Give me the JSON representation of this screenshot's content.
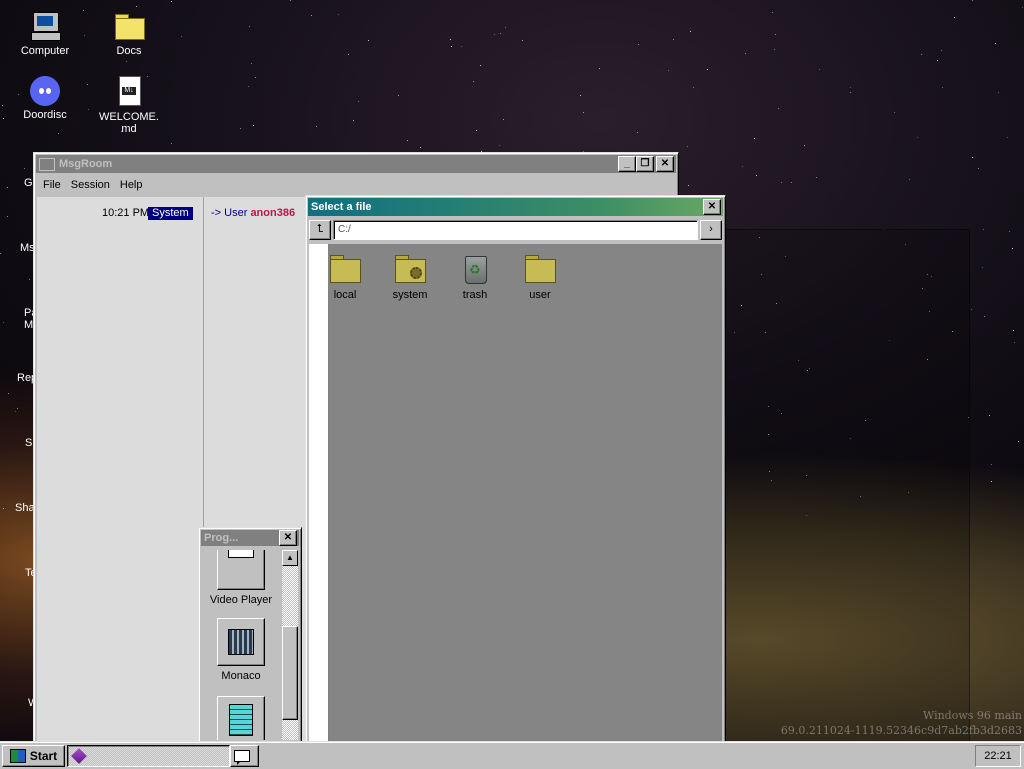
{
  "desktop": {
    "icons": [
      {
        "label": "Computer",
        "icon": "computer-icon"
      },
      {
        "label": "Docs",
        "icon": "folder-icon"
      },
      {
        "label": "Doordisc",
        "icon": "discord-icon"
      },
      {
        "label": "WELCOME.md",
        "icon": "markdown-file-icon"
      }
    ],
    "partial_labels": [
      "G",
      "Ms",
      "Pa",
      "M",
      "Rep",
      "S",
      "Sha",
      "Te",
      "W"
    ],
    "watermark": {
      "line1": "Windows 96 main",
      "line2": "69.0.211024-1119.52346c9d7ab2fb3d2683"
    }
  },
  "msgroom": {
    "title": "MsgRoom",
    "menu": [
      "File",
      "Session",
      "Help"
    ],
    "message": {
      "time": "10:21 PM",
      "sender": "System",
      "text_prefix": "-> User ",
      "user": "anon386"
    }
  },
  "file_dialog": {
    "title": "Select a file",
    "path": "C:/",
    "up_button": "⮤",
    "go_button": "›",
    "items": [
      {
        "label": "local",
        "icon": "folder-icon"
      },
      {
        "label": "system",
        "icon": "system-folder-icon"
      },
      {
        "label": "trash",
        "icon": "trash-icon"
      },
      {
        "label": "user",
        "icon": "folder-icon"
      }
    ]
  },
  "programs": {
    "title": "Prog...",
    "items": [
      {
        "label": "Video Player",
        "icon": "video-player-icon"
      },
      {
        "label": "Monaco",
        "icon": "monaco-icon"
      },
      {
        "label": "",
        "icon": "notepad-icon"
      }
    ]
  },
  "taskbar": {
    "start_label": "Start",
    "clock": "22:21"
  }
}
